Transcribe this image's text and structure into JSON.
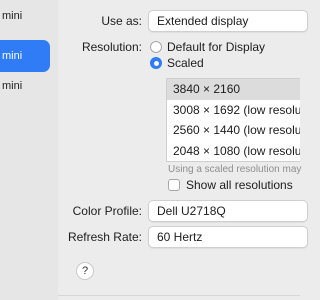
{
  "sidebar": {
    "items": [
      {
        "label": "mini",
        "selected": false
      },
      {
        "label": "mini",
        "selected": true
      },
      {
        "label": "mini",
        "selected": false
      }
    ]
  },
  "display": {
    "use_as_label": "Use as:",
    "use_as_value": "Extended display",
    "resolution_label": "Resolution:",
    "resolution_options": [
      {
        "label": "Default for Display",
        "selected": false
      },
      {
        "label": "Scaled",
        "selected": true
      }
    ],
    "resolutions": [
      "3840 × 2160",
      "3008 × 1692 (low resolut",
      "2560 × 1440 (low resolut",
      "2048 × 1080 (low resolut"
    ],
    "selected_resolution": "3840 × 2160",
    "scaled_hint": "Using a scaled resolution may",
    "show_all_label": "Show all resolutions",
    "show_all_checked": false,
    "color_profile_label": "Color Profile:",
    "color_profile_value": "Dell U2718Q",
    "refresh_rate_label": "Refresh Rate:",
    "refresh_rate_value": "60 Hertz",
    "help_symbol": "?"
  },
  "colors": {
    "accent": "#2f7cf6",
    "window_bg": "#ececec",
    "list_selection": "#dcdcdc"
  }
}
